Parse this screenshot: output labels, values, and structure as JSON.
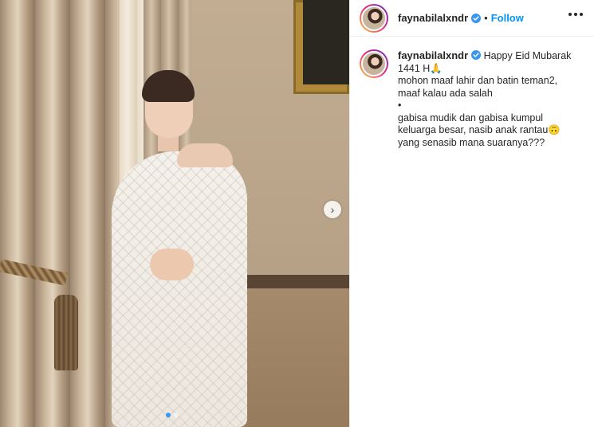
{
  "post": {
    "username": "faynabilalxndr",
    "separator": "•",
    "follow_label": "Follow",
    "caption": {
      "first_line": "Happy Eid Mubarak",
      "line2": "1441 H🙏",
      "line3": "mohon maaf lahir dan batin teman2,",
      "line4": "maaf kalau ada salah",
      "line5": "•",
      "line6": "gabisa mudik dan gabisa kumpul",
      "line7": "keluarga besar, nasib anak rantau🙃",
      "line8": "yang senasib mana suaranya???"
    }
  },
  "carousel": {
    "next_icon": "chevron-right-icon",
    "next_glyph": "›",
    "slide_count": 2,
    "active_slide": 1
  },
  "colors": {
    "follow": "#0095f6",
    "verified": "#3897f0",
    "active_dot": "#3897f0"
  }
}
